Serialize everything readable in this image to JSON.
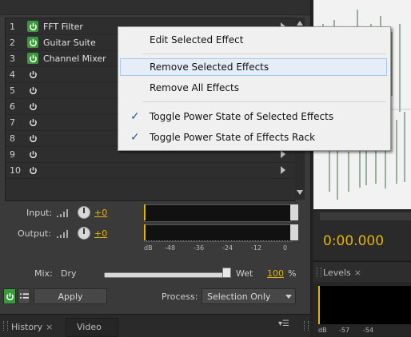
{
  "rack": {
    "slots": [
      {
        "num": "1",
        "name": "FFT Filter",
        "on": true
      },
      {
        "num": "2",
        "name": "Guitar Suite",
        "on": true
      },
      {
        "num": "3",
        "name": "Channel Mixer",
        "on": true
      },
      {
        "num": "4",
        "name": "",
        "on": false
      },
      {
        "num": "5",
        "name": "",
        "on": false
      },
      {
        "num": "6",
        "name": "",
        "on": false
      },
      {
        "num": "7",
        "name": "",
        "on": false
      },
      {
        "num": "8",
        "name": "",
        "on": false
      },
      {
        "num": "9",
        "name": "",
        "on": false
      },
      {
        "num": "10",
        "name": "",
        "on": false
      }
    ],
    "input_label": "Input:",
    "input_value": "+0",
    "output_label": "Output:",
    "output_value": "+0",
    "scale": [
      "dB",
      "-48",
      "-36",
      "-24",
      "-12",
      "0"
    ],
    "mix_label": "Mix:",
    "mix_dry": "Dry",
    "mix_wet": "Wet",
    "mix_value": "100",
    "mix_unit": "%",
    "apply_label": "Apply",
    "process_label": "Process:",
    "process_value": "Selection Only"
  },
  "bottom_tabs": {
    "history": "History",
    "history_close": "×",
    "video": "Video"
  },
  "context_menu": {
    "items": [
      {
        "label": "Edit Selected Effect",
        "checked": false
      },
      {
        "label": "Remove Selected Effects",
        "checked": false,
        "highlighted": true
      },
      {
        "label": "Remove All Effects",
        "checked": false
      },
      {
        "label": "Toggle Power State of Selected Effects",
        "checked": true
      },
      {
        "label": "Toggle Power State of Effects Rack",
        "checked": true
      }
    ],
    "check_glyph": "✓"
  },
  "timecode": "0:00.000",
  "levels": {
    "tab_label": "Levels",
    "tab_close": "×",
    "scale": [
      "dB",
      "-57",
      "-54"
    ]
  },
  "colors": {
    "accent": "#e4b400",
    "power_on": "#3a9a3a"
  }
}
